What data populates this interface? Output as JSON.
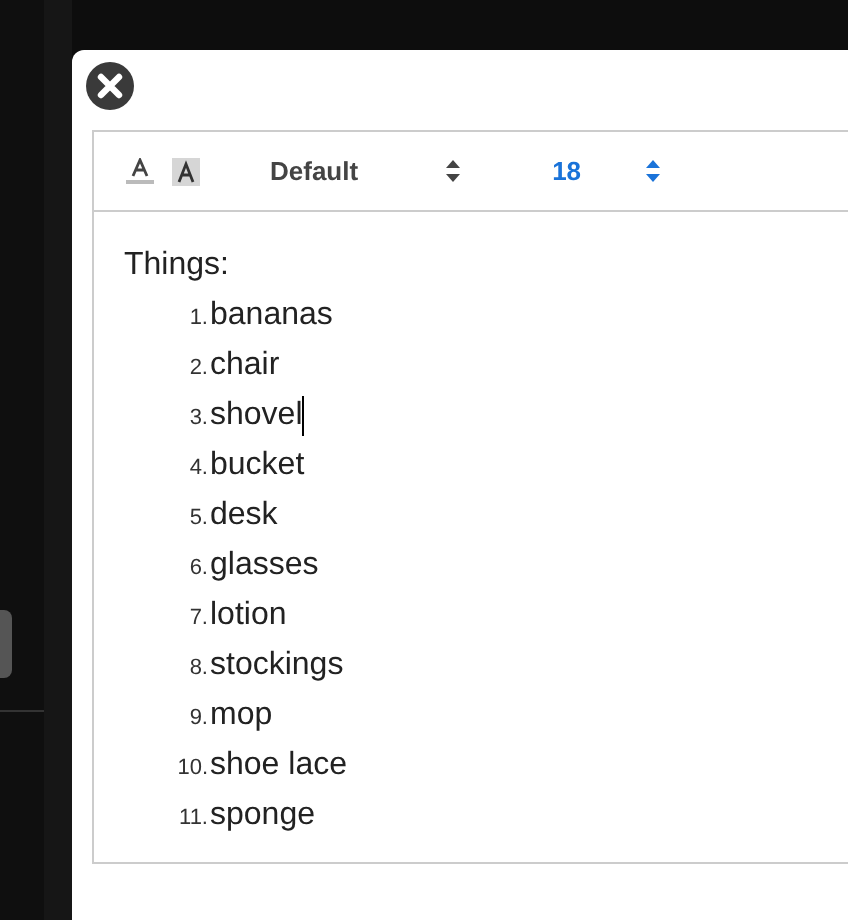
{
  "toolbar": {
    "font": "Default",
    "size": "18"
  },
  "editor": {
    "heading": "Things:",
    "items": [
      {
        "number": "1.",
        "text": "bananas",
        "caret": false
      },
      {
        "number": "2.",
        "text": "chair",
        "caret": false
      },
      {
        "number": "3.",
        "text": "shovel",
        "caret": true
      },
      {
        "number": "4.",
        "text": "bucket",
        "caret": false
      },
      {
        "number": "5.",
        "text": "desk",
        "caret": false
      },
      {
        "number": "6.",
        "text": "glasses",
        "caret": false
      },
      {
        "number": "7.",
        "text": "lotion",
        "caret": false
      },
      {
        "number": "8.",
        "text": "stockings",
        "caret": false
      },
      {
        "number": "9.",
        "text": "mop",
        "caret": false
      },
      {
        "number": "10.",
        "text": "shoe lace",
        "caret": false
      },
      {
        "number": "11.",
        "text": "sponge",
        "caret": false
      }
    ]
  }
}
